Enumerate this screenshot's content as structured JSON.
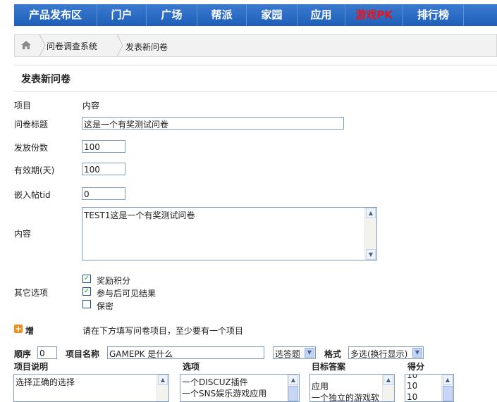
{
  "nav": {
    "items": [
      {
        "label": "产品发布区",
        "accent": false
      },
      {
        "label": "门户",
        "accent": false
      },
      {
        "label": "广场",
        "accent": false
      },
      {
        "label": "帮派",
        "accent": false
      },
      {
        "label": "家园",
        "accent": false
      },
      {
        "label": "应用",
        "accent": false
      },
      {
        "label": "游戏PK",
        "accent": true
      },
      {
        "label": "排行榜",
        "accent": false
      }
    ]
  },
  "breadcrumb": {
    "home_icon": "home-icon",
    "items": [
      "问卷调查系统",
      "发表新问卷"
    ]
  },
  "page_title": "发表新问卷",
  "form": {
    "header_item": "项目",
    "header_content": "内容",
    "title_label": "问卷标题",
    "title_value": "这是一个有奖测试问卷",
    "copies_label": "发放份数",
    "copies_value": "100",
    "validity_label": "有效期(天)",
    "validity_value": "100",
    "tid_label": "嵌入帖tid",
    "tid_value": "0",
    "content_label": "内容",
    "content_value": "TEST1这是一个有奖测试问卷",
    "other_label": "其它选项",
    "options": [
      {
        "label": "奖励积分",
        "checked": true
      },
      {
        "label": "参与后可见结果",
        "checked": true
      },
      {
        "label": "保密",
        "checked": false
      }
    ],
    "add_label": "增",
    "hint": "请在下方填写问卷项目，至少要有一个项目"
  },
  "question": {
    "order_label": "顺序",
    "order_value": "0",
    "name_label": "项目名称",
    "name_value": "GAMEPK 是什么",
    "type_value": "选答题",
    "format_label": "格式",
    "format_value": "多选(换行显示)",
    "desc_label": "项目说明",
    "desc_value": "选择正确的选择",
    "options_label": "选项",
    "options_lines": [
      "一个DISCUZ插件",
      "一个SNS娱乐游戏应用"
    ],
    "target_label": "目标答案",
    "target_lines": [
      "应用",
      "一个独立的游戏软"
    ],
    "score_label": "得分",
    "score_lines": [
      "10",
      "10",
      "10"
    ]
  }
}
